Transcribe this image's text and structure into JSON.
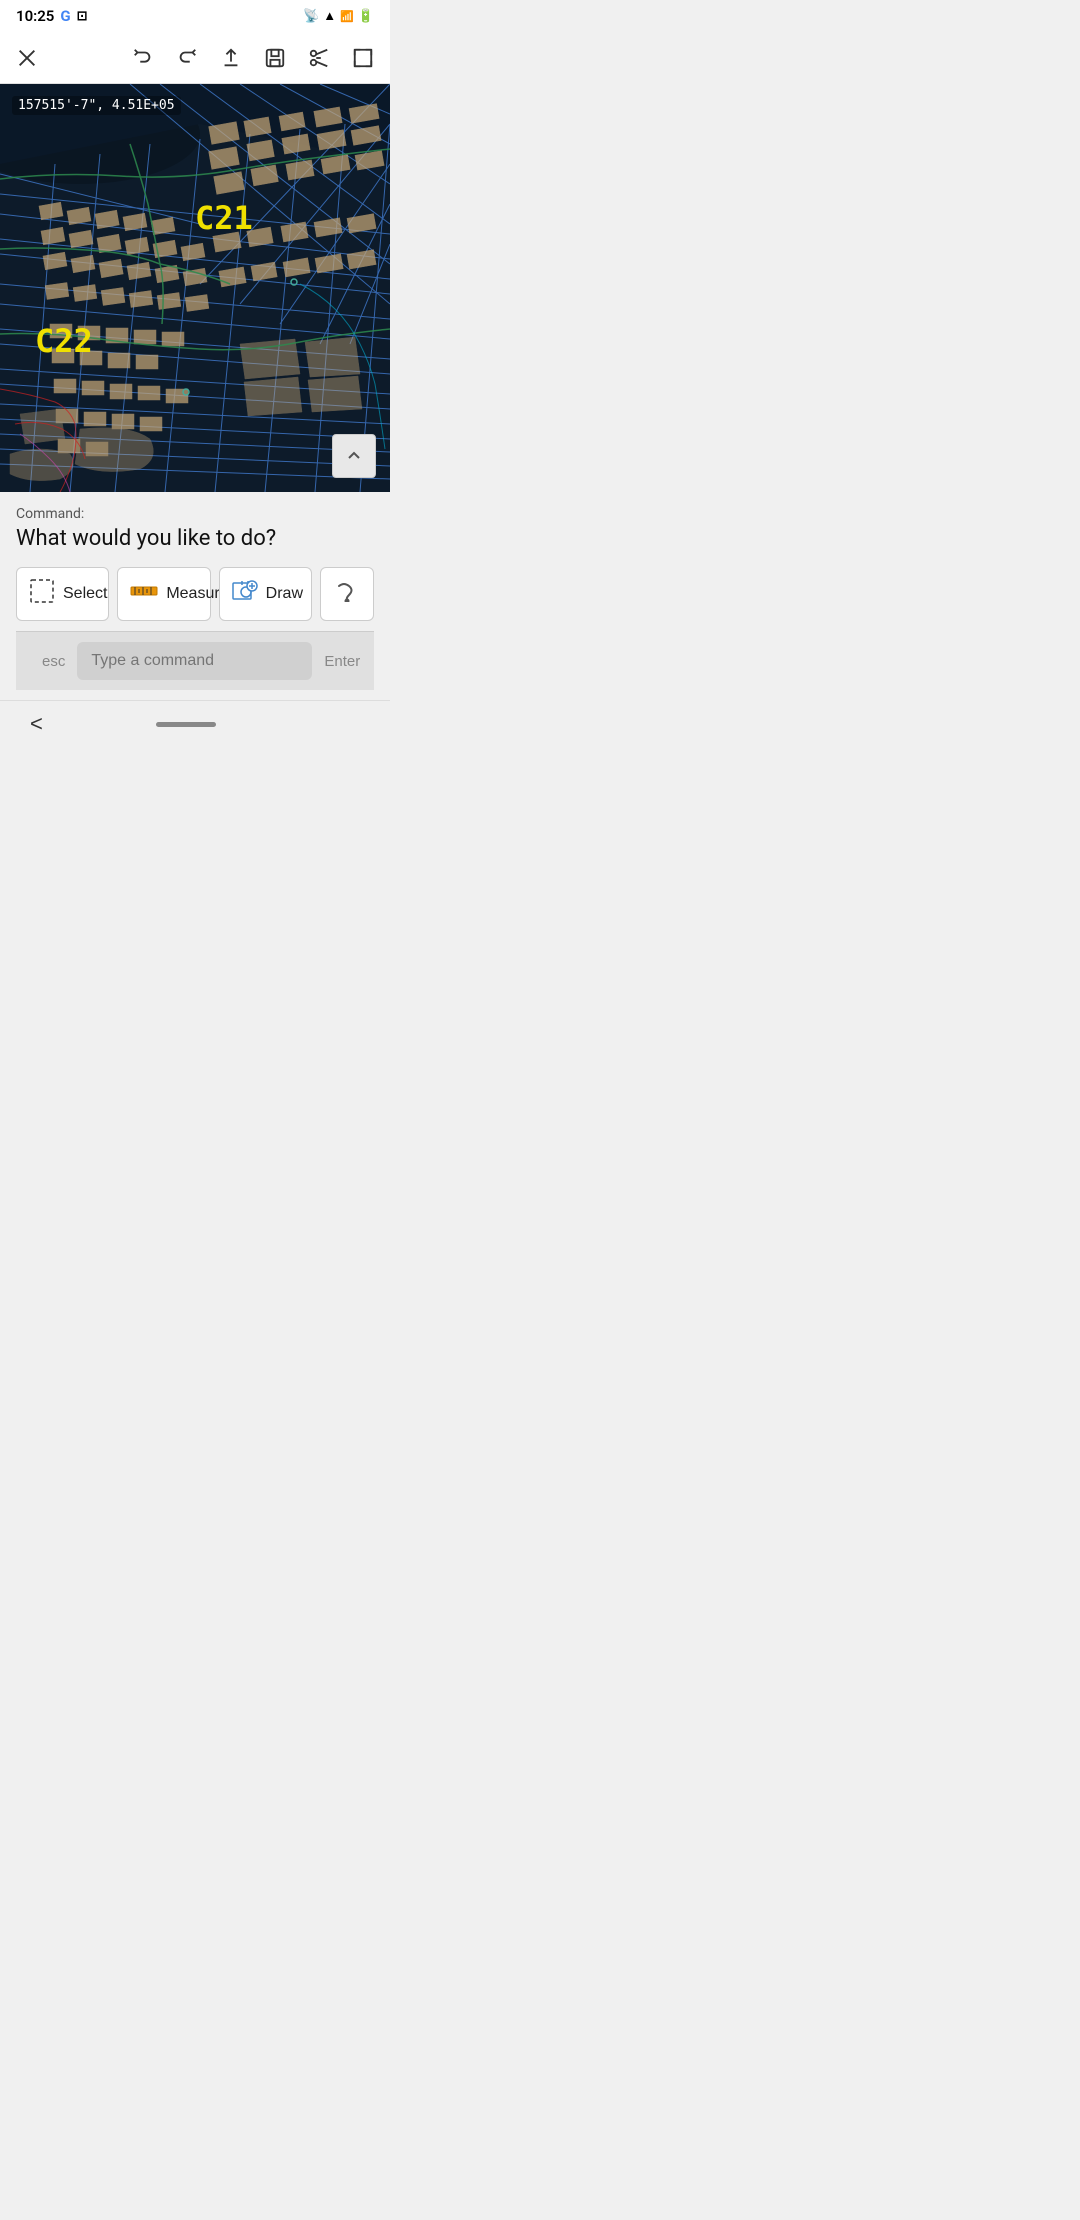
{
  "statusBar": {
    "time": "10:25",
    "icons": [
      "G",
      "screen-record",
      "cast",
      "wifi",
      "signal",
      "battery"
    ]
  },
  "toolbar": {
    "closeLabel": "×",
    "undoLabel": "↩",
    "redoLabel": "↪",
    "shareLabel": "⬆",
    "saveLabel": "💾",
    "scissorsLabel": "✂",
    "expandLabel": "⤢"
  },
  "canvas": {
    "coords": "157515'-7\", 4.51E+05",
    "labelC21": "C21",
    "labelC22": "C22",
    "collapseIcon": "^"
  },
  "commandPanel": {
    "commandLabel": "Command:",
    "questionText": "What would you like to do?",
    "buttons": [
      {
        "id": "select",
        "icon": "select-icon",
        "label": "Select"
      },
      {
        "id": "measure",
        "icon": "measure-icon",
        "label": "Measure"
      },
      {
        "id": "draw",
        "icon": "draw-icon",
        "label": "Draw"
      },
      {
        "id": "more",
        "icon": "more-icon",
        "label": ""
      }
    ]
  },
  "commandInput": {
    "escLabel": "esc",
    "placeholder": "Type a command",
    "enterLabel": "Enter"
  },
  "navBar": {
    "backLabel": "<"
  }
}
